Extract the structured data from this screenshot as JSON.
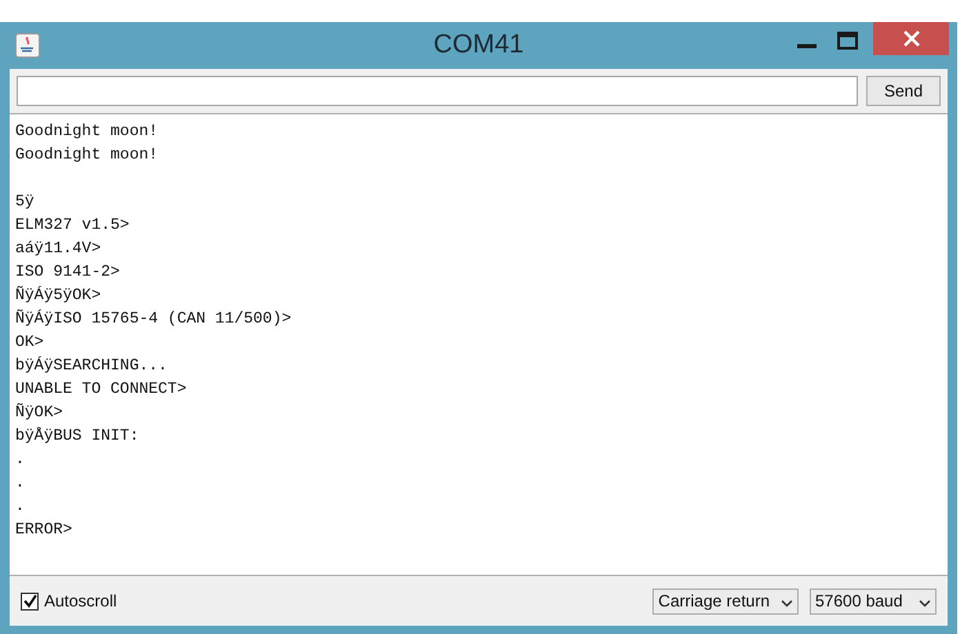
{
  "window": {
    "title": "COM41"
  },
  "send_button": "Send",
  "output": [
    {
      "kind": "line",
      "text": "Goodnight moon!"
    },
    {
      "kind": "line",
      "text": "Goodnight moon!"
    },
    {
      "kind": "blank"
    },
    {
      "kind": "line",
      "text": "5ÿ"
    },
    {
      "kind": "line",
      "text": "ELM327 v1.5>"
    },
    {
      "kind": "line",
      "text": "aáÿ11.4V>"
    },
    {
      "kind": "line",
      "text": "ISO 9141-2>"
    },
    {
      "kind": "line",
      "text": "ÑÿÁÿ5ÿOK>"
    },
    {
      "kind": "line",
      "text": "ÑÿÁÿISO 15765-4 (CAN 11/500)>"
    },
    {
      "kind": "line",
      "text": "OK>"
    },
    {
      "kind": "line",
      "text": "bÿÁÿSEARCHING..."
    },
    {
      "kind": "line",
      "text": "UNABLE TO CONNECT>"
    },
    {
      "kind": "line",
      "text": "ÑÿOK>"
    },
    {
      "kind": "line",
      "text": "bÿÅÿBUS INIT:"
    },
    {
      "kind": "line",
      "text": "."
    },
    {
      "kind": "line",
      "text": "."
    },
    {
      "kind": "line",
      "text": "."
    },
    {
      "kind": "line",
      "text": "ERROR>"
    }
  ],
  "autoscroll": {
    "label": "Autoscroll",
    "checked": true
  },
  "line_ending": "Carriage return",
  "baud_rate": "57600 baud"
}
